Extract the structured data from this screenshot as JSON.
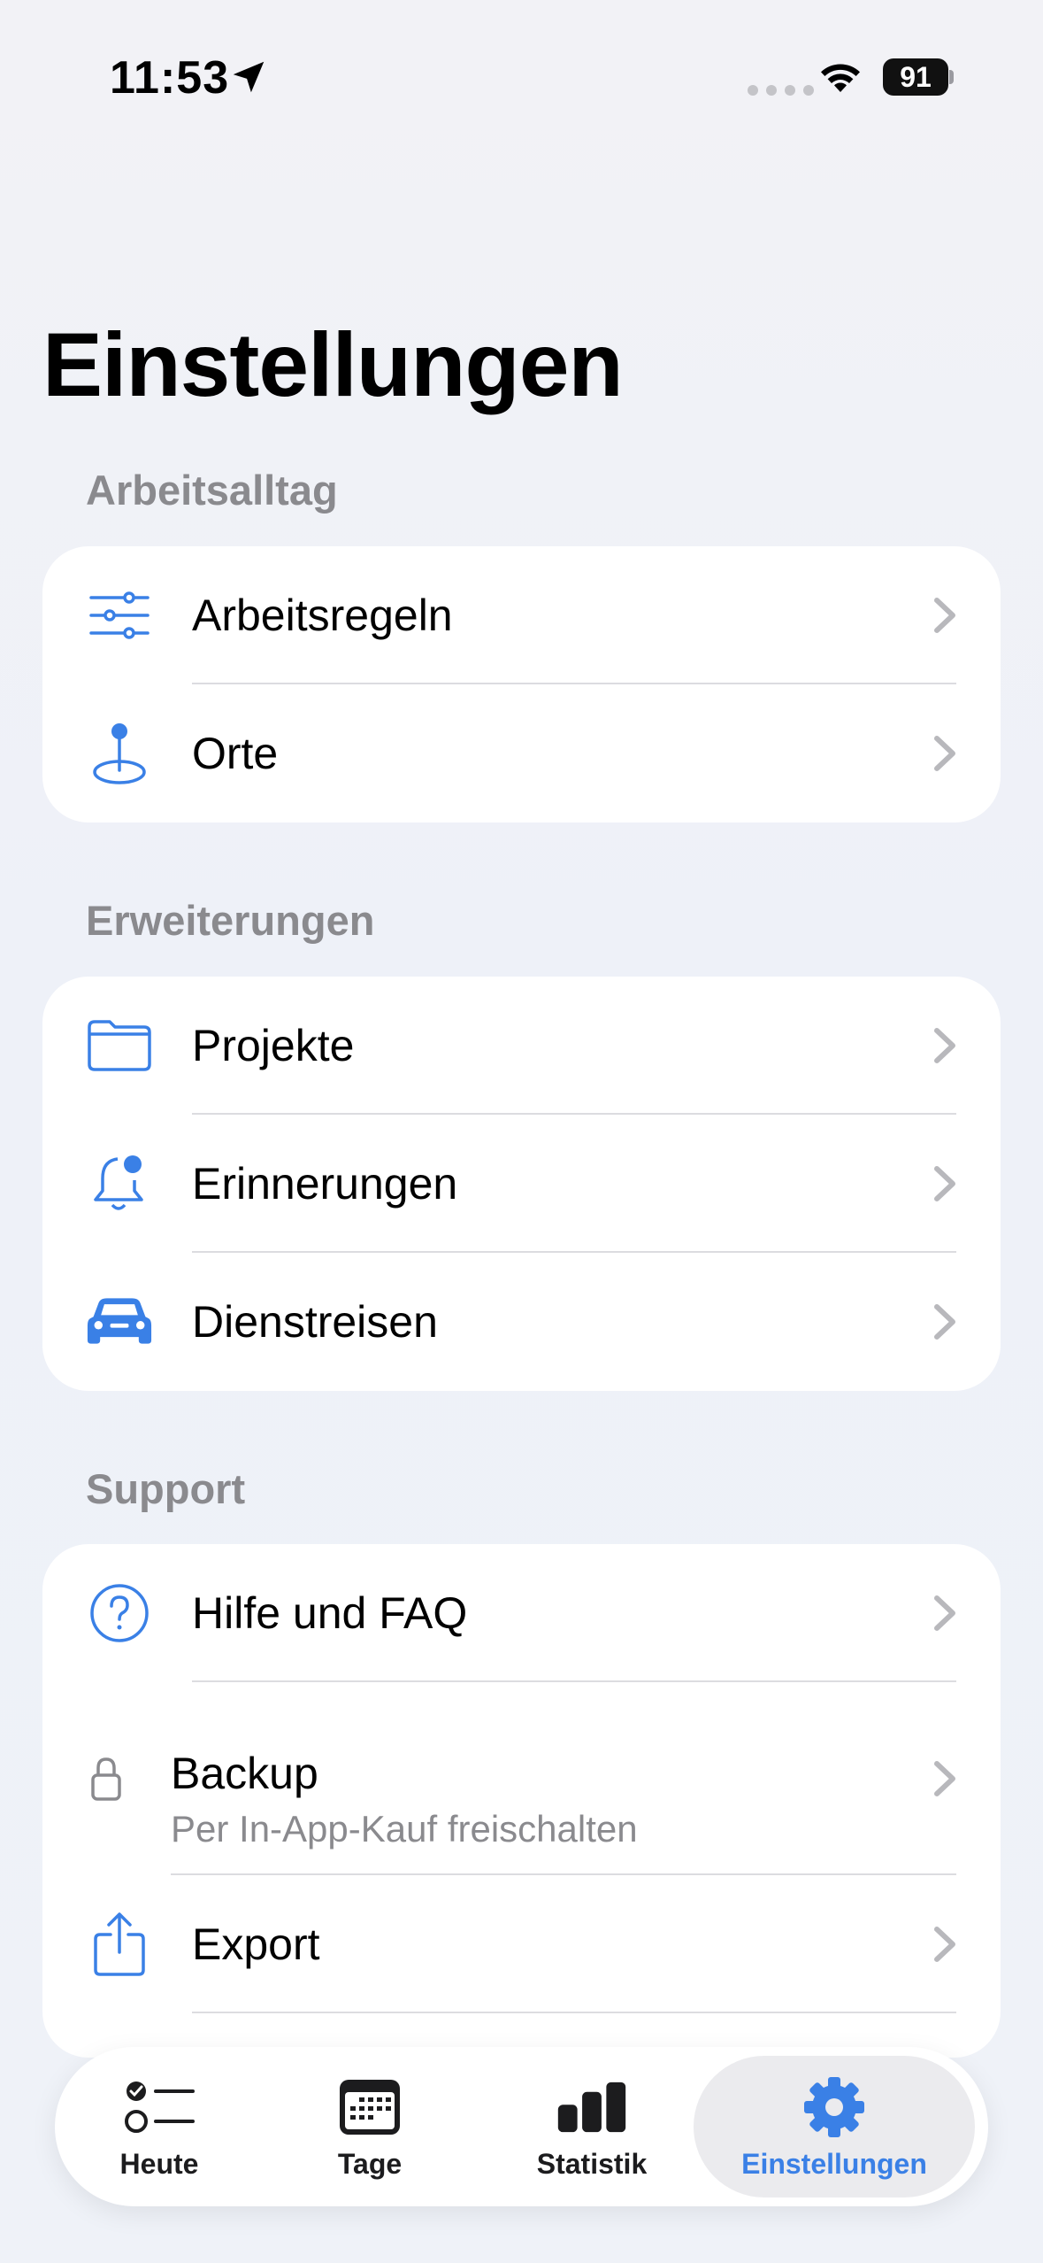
{
  "status_bar": {
    "time": "11:53",
    "battery": "91"
  },
  "page_title": "Einstellungen",
  "sections": [
    {
      "header": "Arbeitsalltag",
      "items": [
        {
          "label": "Arbeitsregeln",
          "icon": "sliders-icon"
        },
        {
          "label": "Orte",
          "icon": "location-pin-icon"
        }
      ]
    },
    {
      "header": "Erweiterungen",
      "items": [
        {
          "label": "Projekte",
          "icon": "folder-icon"
        },
        {
          "label": "Erinnerungen",
          "icon": "bell-badge-icon"
        },
        {
          "label": "Dienstreisen",
          "icon": "car-icon"
        }
      ]
    },
    {
      "header": "Support",
      "items": [
        {
          "label": "Hilfe und FAQ",
          "icon": "question-circle-icon"
        },
        {
          "label": "Backup",
          "sublabel": "Per In-App-Kauf freischalten",
          "icon": "lock-icon"
        },
        {
          "label": "Export",
          "icon": "share-icon"
        }
      ]
    }
  ],
  "tab_bar": {
    "tabs": [
      {
        "label": "Heute",
        "icon": "checklist-icon"
      },
      {
        "label": "Tage",
        "icon": "calendar-icon"
      },
      {
        "label": "Statistik",
        "icon": "bar-chart-icon"
      },
      {
        "label": "Einstellungen",
        "icon": "gear-icon",
        "active": true
      }
    ]
  },
  "colors": {
    "accent": "#3a80e6",
    "section_header": "#8a8a8e",
    "background": "#f2f2f6"
  }
}
